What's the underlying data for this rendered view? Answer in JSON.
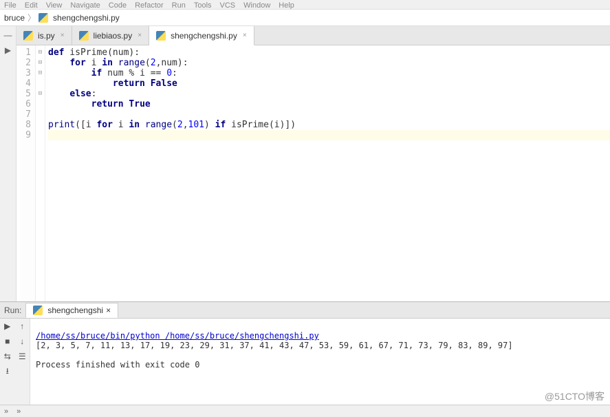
{
  "menubar": [
    "File",
    "Edit",
    "View",
    "Navigate",
    "Code",
    "Refactor",
    "Run",
    "Tools",
    "VCS",
    "Window",
    "Help"
  ],
  "breadcrumb": {
    "project": "bruce",
    "file": "shengchengshi.py"
  },
  "tabs": [
    {
      "label": "is.py",
      "active": false
    },
    {
      "label": "liebiaos.py",
      "active": false
    },
    {
      "label": "shengchengshi.py",
      "active": true
    }
  ],
  "code": {
    "lines": [
      {
        "n": 1,
        "indent": 0,
        "tokens": [
          [
            "kw",
            "def"
          ],
          [
            "",
            " isPrime(num):"
          ]
        ]
      },
      {
        "n": 2,
        "indent": 1,
        "tokens": [
          [
            "kw",
            "for"
          ],
          [
            "",
            " i "
          ],
          [
            "kw",
            "in"
          ],
          [
            "",
            " "
          ],
          [
            "builtin",
            "range"
          ],
          [
            "",
            "("
          ],
          [
            "num",
            "2"
          ],
          [
            "",
            ",num):"
          ]
        ]
      },
      {
        "n": 3,
        "indent": 2,
        "tokens": [
          [
            "kw",
            "if"
          ],
          [
            "",
            " num % i == "
          ],
          [
            "num",
            "0"
          ],
          [
            "",
            ":"
          ]
        ]
      },
      {
        "n": 4,
        "indent": 3,
        "tokens": [
          [
            "kw",
            "return False"
          ]
        ]
      },
      {
        "n": 5,
        "indent": 1,
        "tokens": [
          [
            "kw",
            "else"
          ],
          [
            "",
            ":"
          ]
        ]
      },
      {
        "n": 6,
        "indent": 2,
        "tokens": [
          [
            "kw",
            "return True"
          ]
        ]
      },
      {
        "n": 7,
        "indent": 0,
        "tokens": [
          [
            "",
            ""
          ]
        ]
      },
      {
        "n": 8,
        "indent": 0,
        "tokens": [
          [
            "builtin",
            "print"
          ],
          [
            "",
            "([i "
          ],
          [
            "kw",
            "for"
          ],
          [
            "",
            " i "
          ],
          [
            "kw",
            "in"
          ],
          [
            "",
            " "
          ],
          [
            "builtin",
            "range"
          ],
          [
            "",
            "("
          ],
          [
            "num",
            "2"
          ],
          [
            "",
            ","
          ],
          [
            "num",
            "101"
          ],
          [
            "",
            ") "
          ],
          [
            "kw",
            "if"
          ],
          [
            "",
            " isPrime(i)])"
          ]
        ]
      },
      {
        "n": 9,
        "indent": 0,
        "tokens": [
          [
            "",
            ""
          ]
        ],
        "current": true
      }
    ],
    "foldables": [
      1,
      2,
      3,
      5
    ]
  },
  "run": {
    "label": "Run:",
    "tab": "shengchengshi",
    "cmd": "/home/ss/bruce/bin/python /home/ss/bruce/shengchengshi.py",
    "out": "[2, 3, 5, 7, 11, 13, 17, 19, 23, 29, 31, 37, 41, 43, 47, 53, 59, 61, 67, 71, 73, 79, 83, 89, 97]",
    "status": "Process finished with exit code 0"
  },
  "watermark": "@51CTO博客"
}
